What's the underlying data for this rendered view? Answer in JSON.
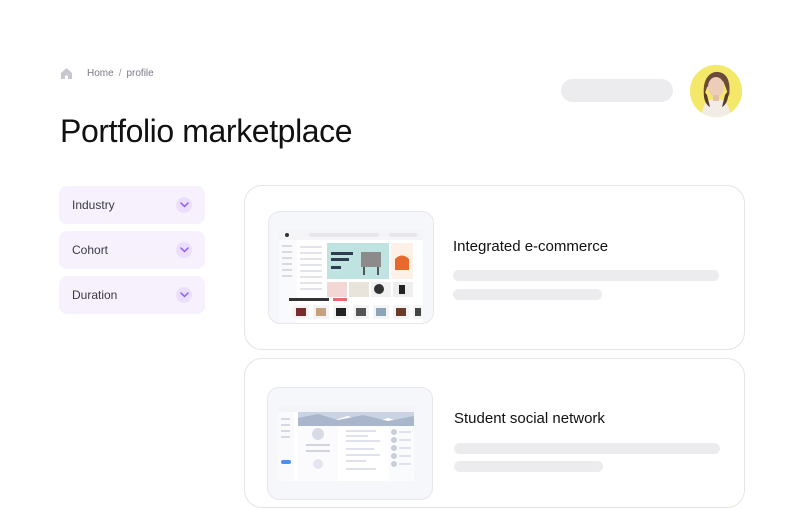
{
  "breadcrumb": {
    "home": "Home",
    "separator": "/",
    "current": "profile"
  },
  "page": {
    "title": "Portfolio marketplace"
  },
  "filters": [
    {
      "label": "Industry"
    },
    {
      "label": "Cohort"
    },
    {
      "label": "Duration"
    }
  ],
  "cards": [
    {
      "title": "Integrated e-commerce"
    },
    {
      "title": "Student social network"
    }
  ],
  "colors": {
    "filter_bg": "#f7f1fe",
    "chevron_bg": "#ecdffc",
    "chevron": "#8b5cf6",
    "avatar_bg": "#f4e86a"
  }
}
